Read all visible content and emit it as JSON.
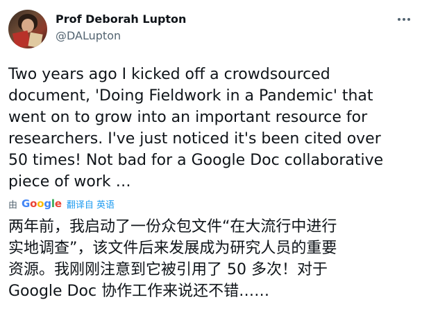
{
  "author": {
    "name": "Prof Deborah Lupton",
    "handle": "@DALupton"
  },
  "more_icon": "more-dots-icon",
  "tweet": {
    "text": "Two years ago I kicked off a crowdsourced\ndocument, 'Doing Fieldwork in a Pandemic' that\nwent on to grow into an important resource for\nresearchers. I've just noticed it's been cited over\n50 times! Not bad for a Google Doc collaborative\npiece of work …"
  },
  "translation": {
    "by_label": "由",
    "provider_letters": [
      "G",
      "o",
      "o",
      "g",
      "l",
      "e"
    ],
    "link_label": "翻译自 英语",
    "text": "两年前，我启动了一份众包文件“在大流行中进行\n实地调查”，该文件后来发展成为研究人员的重要\n资源。我刚刚注意到它被引用了 50 多次！对于\nGoogle Doc 协作工作来说还不错……"
  },
  "colors": {
    "text": "#0f1419",
    "secondary": "#536471",
    "link": "#1d9bf0"
  }
}
